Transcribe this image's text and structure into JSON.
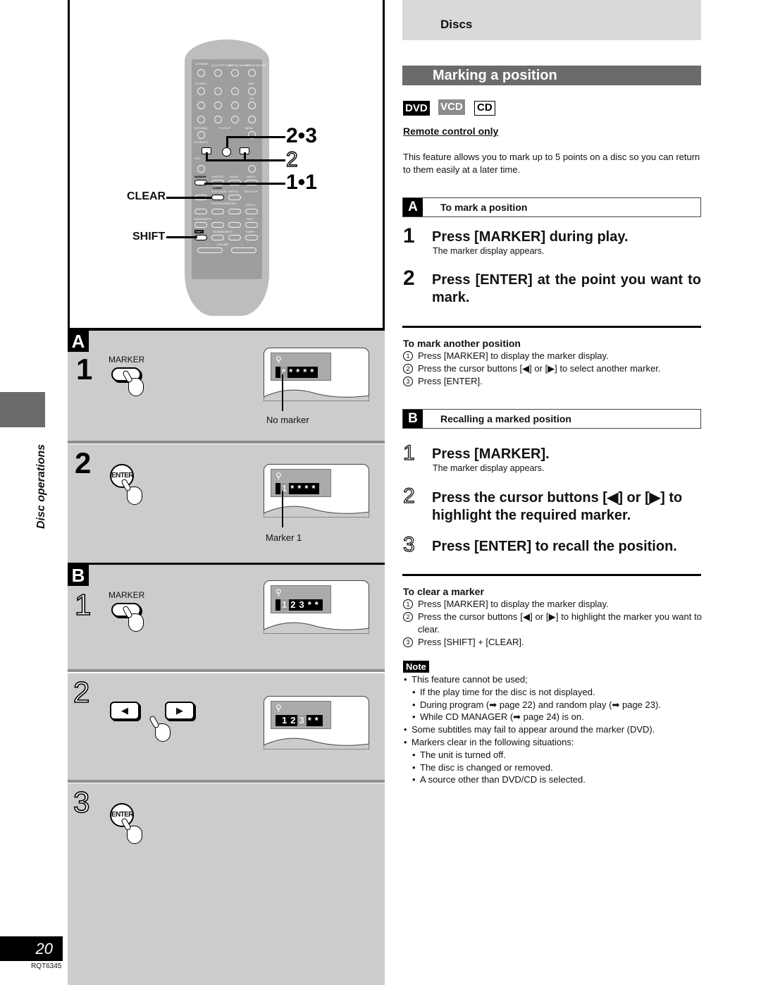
{
  "side": {
    "section_title": "Disc operations",
    "page_number": "20",
    "doc_code": "RQT6345"
  },
  "remote": {
    "callouts": {
      "enter": "2•3",
      "cursor": "2",
      "marker": "1•1"
    },
    "key_labels": {
      "clear": "CLEAR",
      "shift": "SHIFT"
    },
    "button_labels": [
      "TV POWER",
      "AUTO OFF SLEEP",
      "MIX 2CH DIMMER",
      "ACTION MUTING",
      "TV/VIDEO",
      "DISC",
      "≥10",
      "TOP MENU",
      "TV CH UP",
      "MENU",
      "CH SELECT",
      "ENTER",
      "TEST",
      "MARKER",
      "SUBTITLE",
      "AUDIO",
      "ANGLE",
      "CLEAR",
      "PLAY MODE",
      "REPEAT",
      "SELECTOR",
      "POSITION MEMORY",
      "DVD/CD",
      "SUBWOOFER",
      "TAPE",
      "SHIFT",
      "SLOW/SEARCH",
      "TUNER",
      "VOLUME",
      "−",
      "+"
    ]
  },
  "illustrations": {
    "A": {
      "letter": "A",
      "steps": [
        {
          "num": "1",
          "button": "MARKER",
          "osd": [
            "*",
            "*",
            "*",
            "*",
            "*"
          ],
          "selected": 0,
          "pointer_label": "No marker"
        },
        {
          "num": "2",
          "button": "ENTER",
          "osd": [
            "1",
            "*",
            "*",
            "*",
            "*"
          ],
          "selected": 0,
          "pointer_label": "Marker 1"
        }
      ]
    },
    "B": {
      "letter": "B",
      "steps": [
        {
          "num": "1",
          "button": "MARKER",
          "osd": [
            "1",
            "2",
            "3",
            "*",
            "*"
          ],
          "selected": 0
        },
        {
          "num": "2",
          "buttons": [
            "◀",
            "▶"
          ],
          "osd": [
            "1",
            "2",
            "3",
            "*",
            "*"
          ],
          "selected": 2
        },
        {
          "num": "3",
          "button": "ENTER"
        }
      ]
    }
  },
  "header": {
    "category": "Discs",
    "title": "Marking a position"
  },
  "badges": {
    "dvd": "DVD",
    "vcd": "VCD",
    "cd": "CD"
  },
  "remote_only": "Remote control only",
  "intro": "This feature allows you to mark up to 5 points on a disc so you can return to them easily at a later time.",
  "section_a": {
    "letter": "A",
    "title": "To mark a position",
    "steps": [
      {
        "num": "1",
        "text": "Press [MARKER] during play.",
        "sub": "The marker display appears."
      },
      {
        "num": "2",
        "text": "Press [ENTER] at the point you want to mark."
      }
    ],
    "another": {
      "heading": "To mark another position",
      "items": [
        {
          "n": "1",
          "text": "Press [MARKER] to display the marker display."
        },
        {
          "n": "2",
          "text": "Press the cursor buttons [◀] or [▶] to select another marker."
        },
        {
          "n": "3",
          "text": "Press [ENTER]."
        }
      ]
    }
  },
  "section_b": {
    "letter": "B",
    "title": "Recalling a marked position",
    "steps": [
      {
        "num": "1",
        "text": "Press [MARKER].",
        "sub": "The marker display appears."
      },
      {
        "num": "2",
        "text": "Press the cursor buttons [◀] or [▶] to highlight the required marker."
      },
      {
        "num": "3",
        "text": "Press [ENTER] to recall the position."
      }
    ],
    "clear": {
      "heading": "To clear a marker",
      "items": [
        {
          "n": "1",
          "text": "Press [MARKER] to display the marker display."
        },
        {
          "n": "2",
          "text": "Press the cursor buttons [◀] or [▶] to highlight the marker you want to clear."
        },
        {
          "n": "3",
          "text": "Press [SHIFT] + [CLEAR]."
        }
      ]
    }
  },
  "note": {
    "label": "Note",
    "items": [
      {
        "level": 1,
        "text": "This feature cannot be used;"
      },
      {
        "level": 2,
        "text": "If the play time for the disc is not displayed."
      },
      {
        "level": 2,
        "text": "During program (➡ page 22) and random play (➡ page 23)."
      },
      {
        "level": 2,
        "text": "While CD MANAGER (➡ page 24) is on."
      },
      {
        "level": 1,
        "text": "Some subtitles may fail to appear around the marker (DVD)."
      },
      {
        "level": 1,
        "text": "Markers clear in the following situations:"
      },
      {
        "level": 2,
        "text": "The unit is turned off."
      },
      {
        "level": 2,
        "text": "The disc is changed or removed."
      },
      {
        "level": 2,
        "text": "A source other than DVD/CD is selected."
      }
    ]
  }
}
